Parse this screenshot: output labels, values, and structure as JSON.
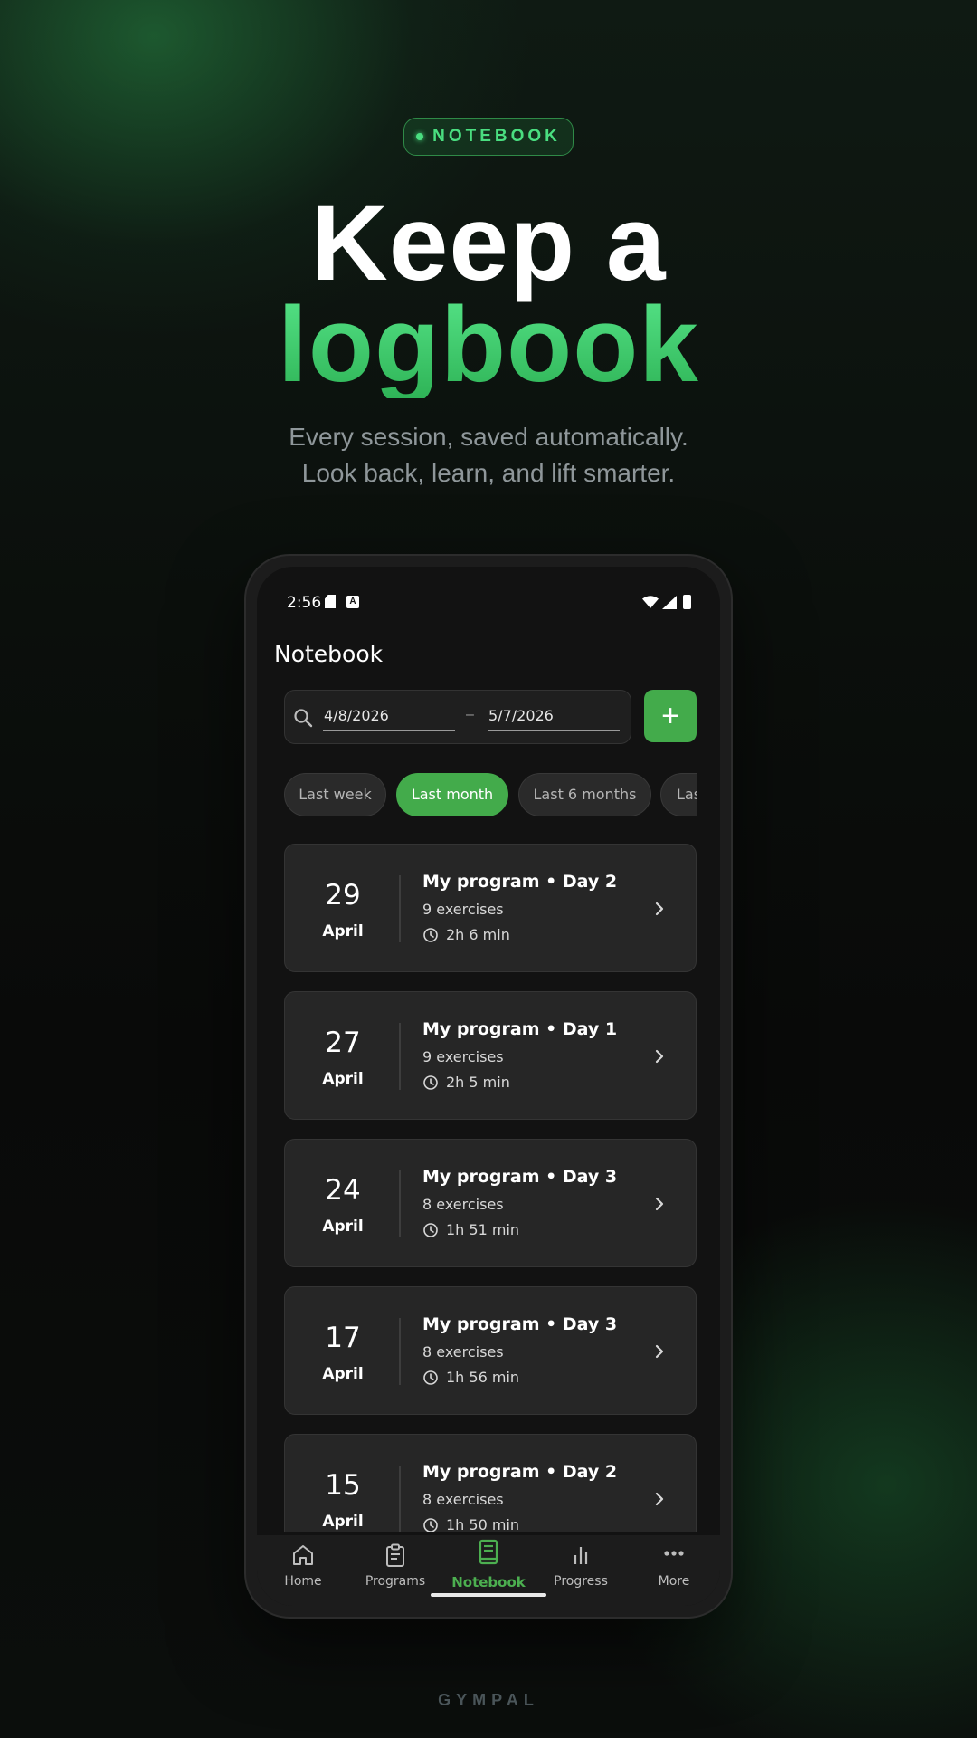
{
  "hero": {
    "badge": "NOTEBOOK",
    "headline_line1": "Keep a",
    "headline_line2": "logbook",
    "subtitle_line1": "Every session, saved automatically.",
    "subtitle_line2": "Look back, learn, and lift smarter."
  },
  "status_bar": {
    "time": "2:56"
  },
  "app": {
    "title": "Notebook",
    "date_from": "4/8/2026",
    "date_separator": "–",
    "date_to": "5/7/2026",
    "add_button_label": "+"
  },
  "filters": [
    {
      "label": "Last week",
      "active": false
    },
    {
      "label": "Last month",
      "active": true
    },
    {
      "label": "Last 6 months",
      "active": false
    },
    {
      "label": "Last year",
      "active": false
    }
  ],
  "sessions": [
    {
      "day": "29",
      "month": "April",
      "title": "My program • Day 2",
      "exercises": "9 exercises",
      "duration": "2h 6 min"
    },
    {
      "day": "27",
      "month": "April",
      "title": "My program • Day 1",
      "exercises": "9 exercises",
      "duration": "2h 5 min"
    },
    {
      "day": "24",
      "month": "April",
      "title": "My program • Day 3",
      "exercises": "8 exercises",
      "duration": "1h 51 min"
    },
    {
      "day": "17",
      "month": "April",
      "title": "My program • Day 3",
      "exercises": "8 exercises",
      "duration": "1h 56 min"
    },
    {
      "day": "15",
      "month": "April",
      "title": "My program • Day 2",
      "exercises": "8 exercises",
      "duration": "1h 50 min"
    }
  ],
  "bottom_nav": [
    {
      "label": "Home",
      "icon": "home-icon",
      "active": false
    },
    {
      "label": "Programs",
      "icon": "clipboard-icon",
      "active": false
    },
    {
      "label": "Notebook",
      "icon": "notebook-icon",
      "active": true
    },
    {
      "label": "Progress",
      "icon": "bar-chart-icon",
      "active": false
    },
    {
      "label": "More",
      "icon": "more-icon",
      "active": false
    }
  ],
  "footer": {
    "brand": "GYMPAL"
  },
  "colors": {
    "accent": "#43ab4b",
    "accent_text": "#4ade80",
    "card_bg": "#262626",
    "screen_bg": "#121212"
  }
}
